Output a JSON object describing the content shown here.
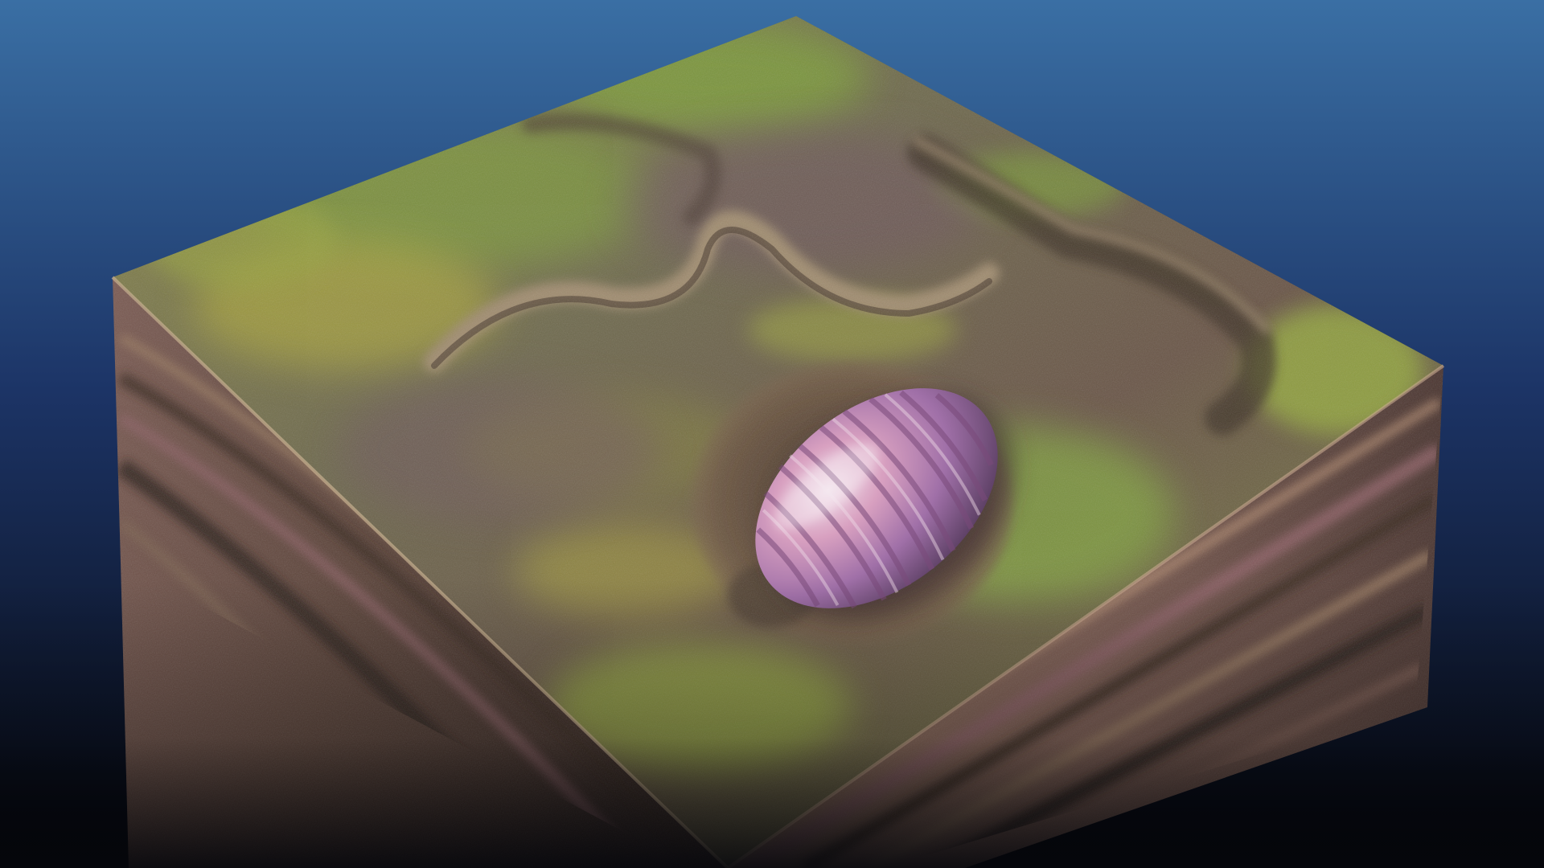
{
  "scene": {
    "subject": "sediment-block-with-burrowing-organism",
    "colors": {
      "background_top": "#3a6fa4",
      "background_mid": "#1c3466",
      "background_bottom": "#06070d",
      "moss_green": "#7fa23a",
      "moss_yellow": "#b8b23a",
      "mud_brown": "#6b5540",
      "mud_purple": "#6f5460",
      "layer_dark": "#3a2a22",
      "layer_light": "#9a7a60",
      "layer_pink": "#8a5f64",
      "creature_purple": "#a070a8",
      "creature_pink": "#d8a0c0",
      "creature_highlight": "#f0dce8"
    }
  }
}
